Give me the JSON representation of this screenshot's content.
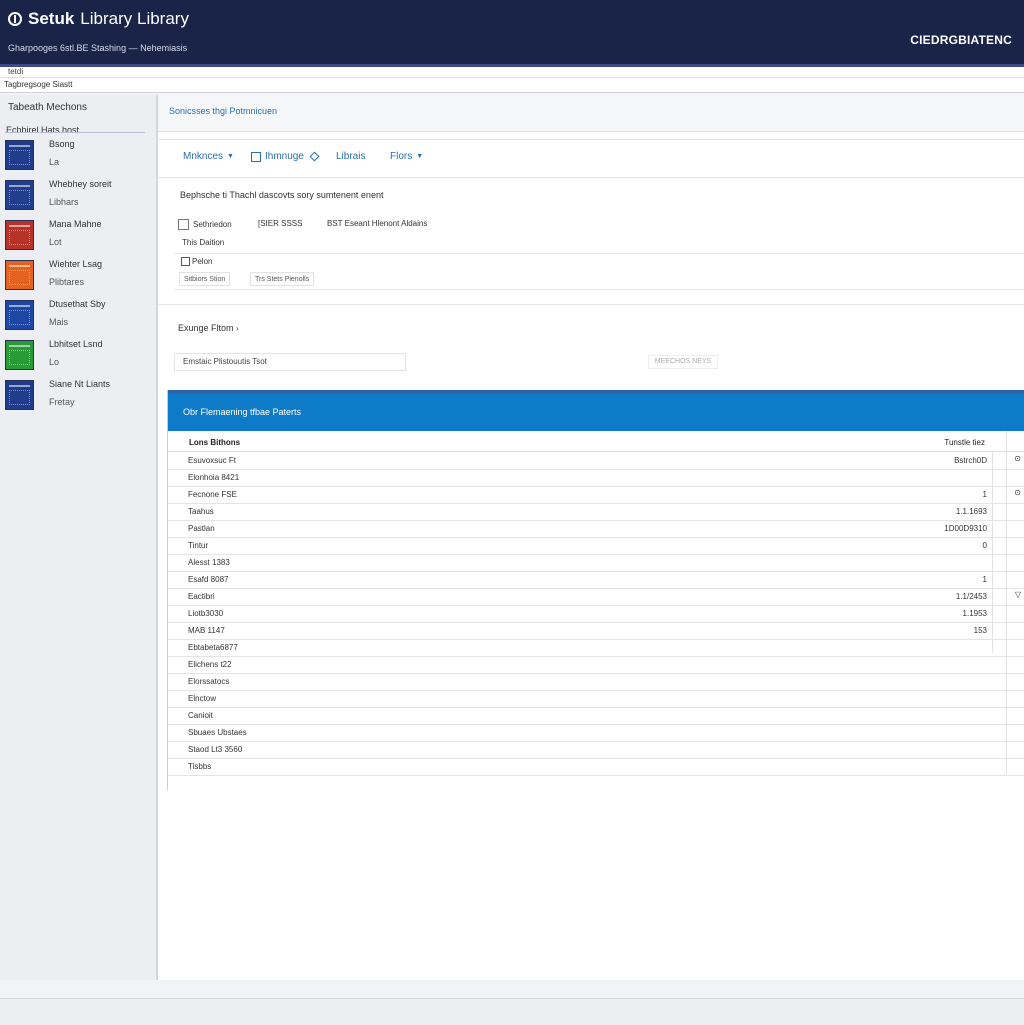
{
  "topbar": {
    "title": "Setuk",
    "title_rest": "Library Library",
    "subtitle": "Gharpooges 6stl.BE Stashing — Nehemiasis",
    "brand": "CIEDRGBIATENC"
  },
  "strip1": {
    "text": "tetdi"
  },
  "strip2": {
    "text": "Tagbregsoge Siastt"
  },
  "sidebar": {
    "title": "Tabeath Mechons",
    "sub": "Echbirel Hats host",
    "books": [
      {
        "line1": "Bsong",
        "line2": "La",
        "color": "#1f3c8a"
      },
      {
        "line1": "Whebhey soreit",
        "line2": "Libhars",
        "color": "#213e8c"
      },
      {
        "line1": "Mana Mahne",
        "line2": "Lot",
        "color": "#b6332a"
      },
      {
        "line1": "Wiehter Lsag",
        "line2": "Plibtares",
        "color": "#e4621f"
      },
      {
        "line1": "Dtusethat Sby",
        "line2": "Mais",
        "color": "#1d47a3"
      },
      {
        "line1": "Lbhitset Lsnd",
        "line2": "Lo",
        "color": "#2a9a36"
      },
      {
        "line1": "Siane Nt Liants",
        "line2": "Fretay",
        "color": "#1f3c8a"
      }
    ]
  },
  "main": {
    "title": "Sonicsses thgi Potmnicuen",
    "tabs": [
      {
        "label": "Mnknces"
      },
      {
        "label": "Ihmnuge"
      },
      {
        "label": "Librais"
      },
      {
        "label": "Flors"
      }
    ],
    "description": "Bephsche ti Thachl dascovts sory sumtenent enent",
    "options": [
      {
        "label": "Sethriedon"
      },
      {
        "label": "[SIER SSSS"
      },
      {
        "label": "BST Eseant Hlenont Aldains"
      }
    ],
    "label_filter": "This Daition",
    "check_label": "Pelon",
    "small_buttons": [
      "Sitbiors Stion",
      "Trs Stets Pienolls"
    ],
    "browse_label": "Exunge Fltom",
    "search_field_value": "Emstaic Plistouutis Tsot",
    "ghost_button": "MEECHOS NEYS"
  },
  "table": {
    "header": "Obr Flemaening tfbae Paterts",
    "col1": "Lons Bithons",
    "col2": "Tunstle tiez",
    "rows": [
      {
        "name": "Esuvoxsuc Ft",
        "value": "Bstrch0D",
        "mark": "⊙"
      },
      {
        "name": "Elonhoia 8421",
        "value": "",
        "mark": ""
      },
      {
        "name": "Fecnone FSE",
        "value": "1",
        "mark": "⊙"
      },
      {
        "name": "Taahus",
        "value": "1.1.1693",
        "mark": ""
      },
      {
        "name": "Pastlan",
        "value": "1D00D9310",
        "mark": ""
      },
      {
        "name": "Tintur",
        "value": "0",
        "mark": ""
      },
      {
        "name": "Alesst 1383",
        "value": "",
        "mark": ""
      },
      {
        "name": "Esafd 8087",
        "value": "1",
        "mark": ""
      },
      {
        "name": "Eactibri",
        "value": "1.1/2453",
        "mark": "▽"
      },
      {
        "name": "Liotb3030",
        "value": "1.1953",
        "mark": ""
      },
      {
        "name": "MAB 1147",
        "value": "153",
        "mark": ""
      },
      {
        "name": "Ebtabeta6877",
        "value": "",
        "mark": ""
      },
      {
        "name": "Elichens t22",
        "value": "",
        "mark": ""
      },
      {
        "name": "Elorssatocs",
        "value": "",
        "mark": ""
      },
      {
        "name": "Elnctow",
        "value": "",
        "mark": ""
      },
      {
        "name": "Canioit",
        "value": "",
        "mark": ""
      },
      {
        "name": "Sbuaes Ubstaes",
        "value": "",
        "mark": ""
      },
      {
        "name": "Staod Lt3 3560",
        "value": "",
        "mark": ""
      },
      {
        "name": "Tisbbs",
        "value": "",
        "mark": ""
      }
    ]
  }
}
